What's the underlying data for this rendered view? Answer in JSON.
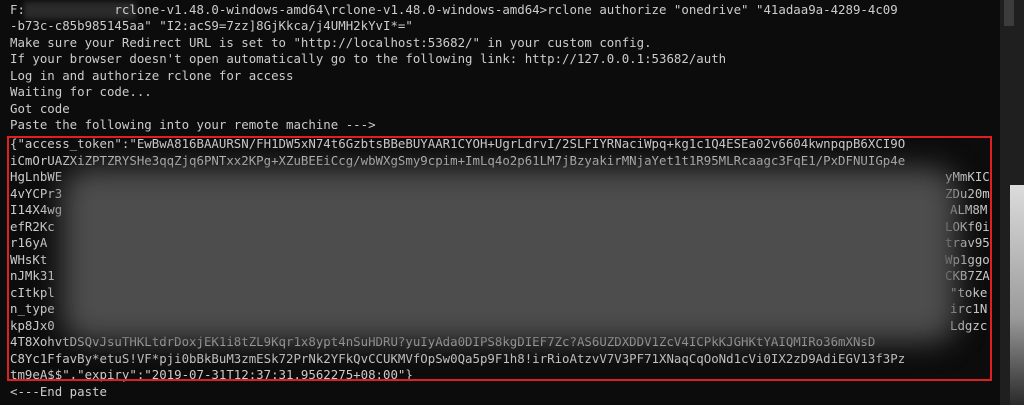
{
  "console": {
    "lines": [
      "F:            rclone-v1.48.0-windows-amd64\\rclone-v1.48.0-windows-amd64>rclone authorize \"onedrive\" \"41adaa9a-4289-4c09",
      "-b73c-c85b985145aa\" \"I2:acS9=7zz]8GjKkca/j4UMH2kYvI*=\"",
      "Make sure your Redirect URL is set to \"http://localhost:53682/\" in your custom config.",
      "If your browser doesn't open automatically go to the following link: http://127.0.0.1:53682/auth",
      "Log in and authorize rclone for access",
      "Waiting for code...",
      "Got code",
      "Paste the following into your remote machine --->",
      "{\"access_token\":\"EwBwA816BAAURSN/FH1DW5xN74t6GzbtsBBeBUYAAR1CYOH+UgrLdrvI/2SLFIYRNaciWpq+kg1c1Q4ESEa02v6604kwnpqpB6XCI9O",
      "iCmOrUAZXiZPTZRYSHe3qqZjq6PNTxx2KPg+XZuBEEiCcg/wbWXgSmy9cpim+ImLq4o2p61LM7jBzyakirMNjaYet1t1R95MLRcaagc3FqE1/PxDFNUIGp4e",
      "HgLnbWE",
      "4vYCPr3",
      "I14X4wg",
      "efR2Kc",
      "r16yA",
      "WHsKt",
      "nJMk31",
      "cItkpl",
      "n_type",
      "kp8Jx0",
      "4T8XohvtDSQvJsuTHKLtdrDoxjEK1i8tZL9Kqr1x8ypt4nSuHDRU?yuIyAda0DIPS8kgDIEF7Zc?AS6UZDXDDV1ZcV4ICPkKJGHKtYAIQMIRo36mXNsD",
      "C8Yc1FfavBy*etuS!VF*pji0bBkBuM3zmESk72PrNk2YFkQvCCUKMVfOpSw0Qa5p9F1h8!irRioAtzvV7V3PF71XNaqCqOoNd1cVi0IX2zD9AdiEGV13f3Pz",
      "tm9eA$$\",\"expiry\":\"2019-07-31T12:37:31.9562275+08:00\"}",
      "<---End paste"
    ],
    "right_fragments": [
      {
        "row": 10,
        "text": "yMmKIC"
      },
      {
        "row": 11,
        "text": "ZDu20m"
      },
      {
        "row": 12,
        "text": "ALM8M"
      },
      {
        "row": 13,
        "text": "LOKf0i"
      },
      {
        "row": 14,
        "text": "trav95"
      },
      {
        "row": 15,
        "text": "Wp1ggo"
      },
      {
        "row": 16,
        "text": "CKB7ZA"
      },
      {
        "row": 17,
        "text": "\"toke"
      },
      {
        "row": 18,
        "text": "irc1N"
      },
      {
        "row": 19,
        "text": "Ldgzc"
      }
    ]
  },
  "colors": {
    "background": "#0c0c0c",
    "text": "#cccccc",
    "highlight_border": "#e02020"
  }
}
